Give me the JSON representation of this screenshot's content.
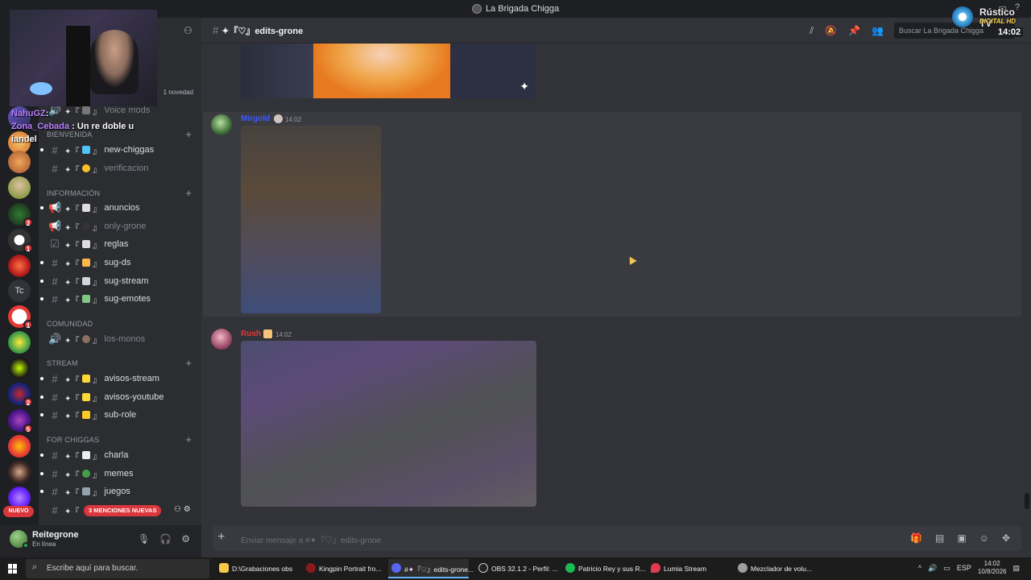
{
  "window": {
    "title": "La Brigada Chigga"
  },
  "sidebar": {
    "novedad": "1 novedad",
    "categories": [
      {
        "label": "BIENVENIDA",
        "top": 0
      },
      {
        "label": "INFORMACIÓN",
        "top": 0
      },
      {
        "label": "COMUNIDAD",
        "top": 0
      },
      {
        "label": "STREAM",
        "top": 0
      },
      {
        "label": "FOR CHIGGAS",
        "top": 0
      }
    ],
    "channels": {
      "voice_mods": "Voice mods",
      "new_chiggas": "new-chiggas",
      "verificacion": "verificacion",
      "anuncios": "anuncios",
      "only_grone": "only-grone",
      "reglas": "reglas",
      "sug_ds": "sug-ds",
      "sug_stream": "sug-stream",
      "sug_emotes": "sug-emotes",
      "los_monos": "los-monos",
      "avisos_stream": "avisos-stream",
      "avisos_youtube": "avisos-youtube",
      "sub_role": "sub-role",
      "charla": "charla",
      "memes": "memes",
      "juegos": "juegos"
    },
    "mentions_pill": "3 MENCIONES NUEVAS",
    "nuevo_pill": "NUEVO"
  },
  "servers": {
    "tc_label": "Tc",
    "badges": [
      "2",
      "1",
      "1",
      "2",
      "5"
    ]
  },
  "user": {
    "name": "Reitegrone",
    "status": "En línea"
  },
  "channel_header": {
    "name": "edits-grone",
    "search_placeholder": "Buscar La Brigada Chigga"
  },
  "messages": [
    {
      "author": "Mirgold",
      "time": "14:02",
      "color": "#3d5afe"
    },
    {
      "author": "Rush",
      "time": "14:02",
      "color": "#e53935"
    }
  ],
  "composer": {
    "placeholder": "Enviar mensaje a #✦『♡』edits-grone"
  },
  "overlay": {
    "chat": [
      {
        "user": "NahuGZ",
        "text": ""
      },
      {
        "user": "Zona_Cebada",
        "text": "Un re doble u iandel"
      }
    ],
    "logo_line1": "Rústico TV",
    "logo_line2": "DIGITAL HD",
    "logo_time": "14:02"
  },
  "taskbar": {
    "search_placeholder": "Escribe aquí para buscar.",
    "tasks": [
      {
        "label": "D:\\Grabaciones obs"
      },
      {
        "label": "Kingpin Portrait fro..."
      },
      {
        "label": "#✦『♡』edits-grone..."
      },
      {
        "label": "OBS 32.1.2 - Perfil: ..."
      },
      {
        "label": "Patricio Rey y sus R..."
      },
      {
        "label": "Lumia Stream"
      },
      {
        "label": "Mezclador de volu..."
      }
    ],
    "lang": "ESP",
    "time": "14:02",
    "date": "10/8/2026"
  }
}
